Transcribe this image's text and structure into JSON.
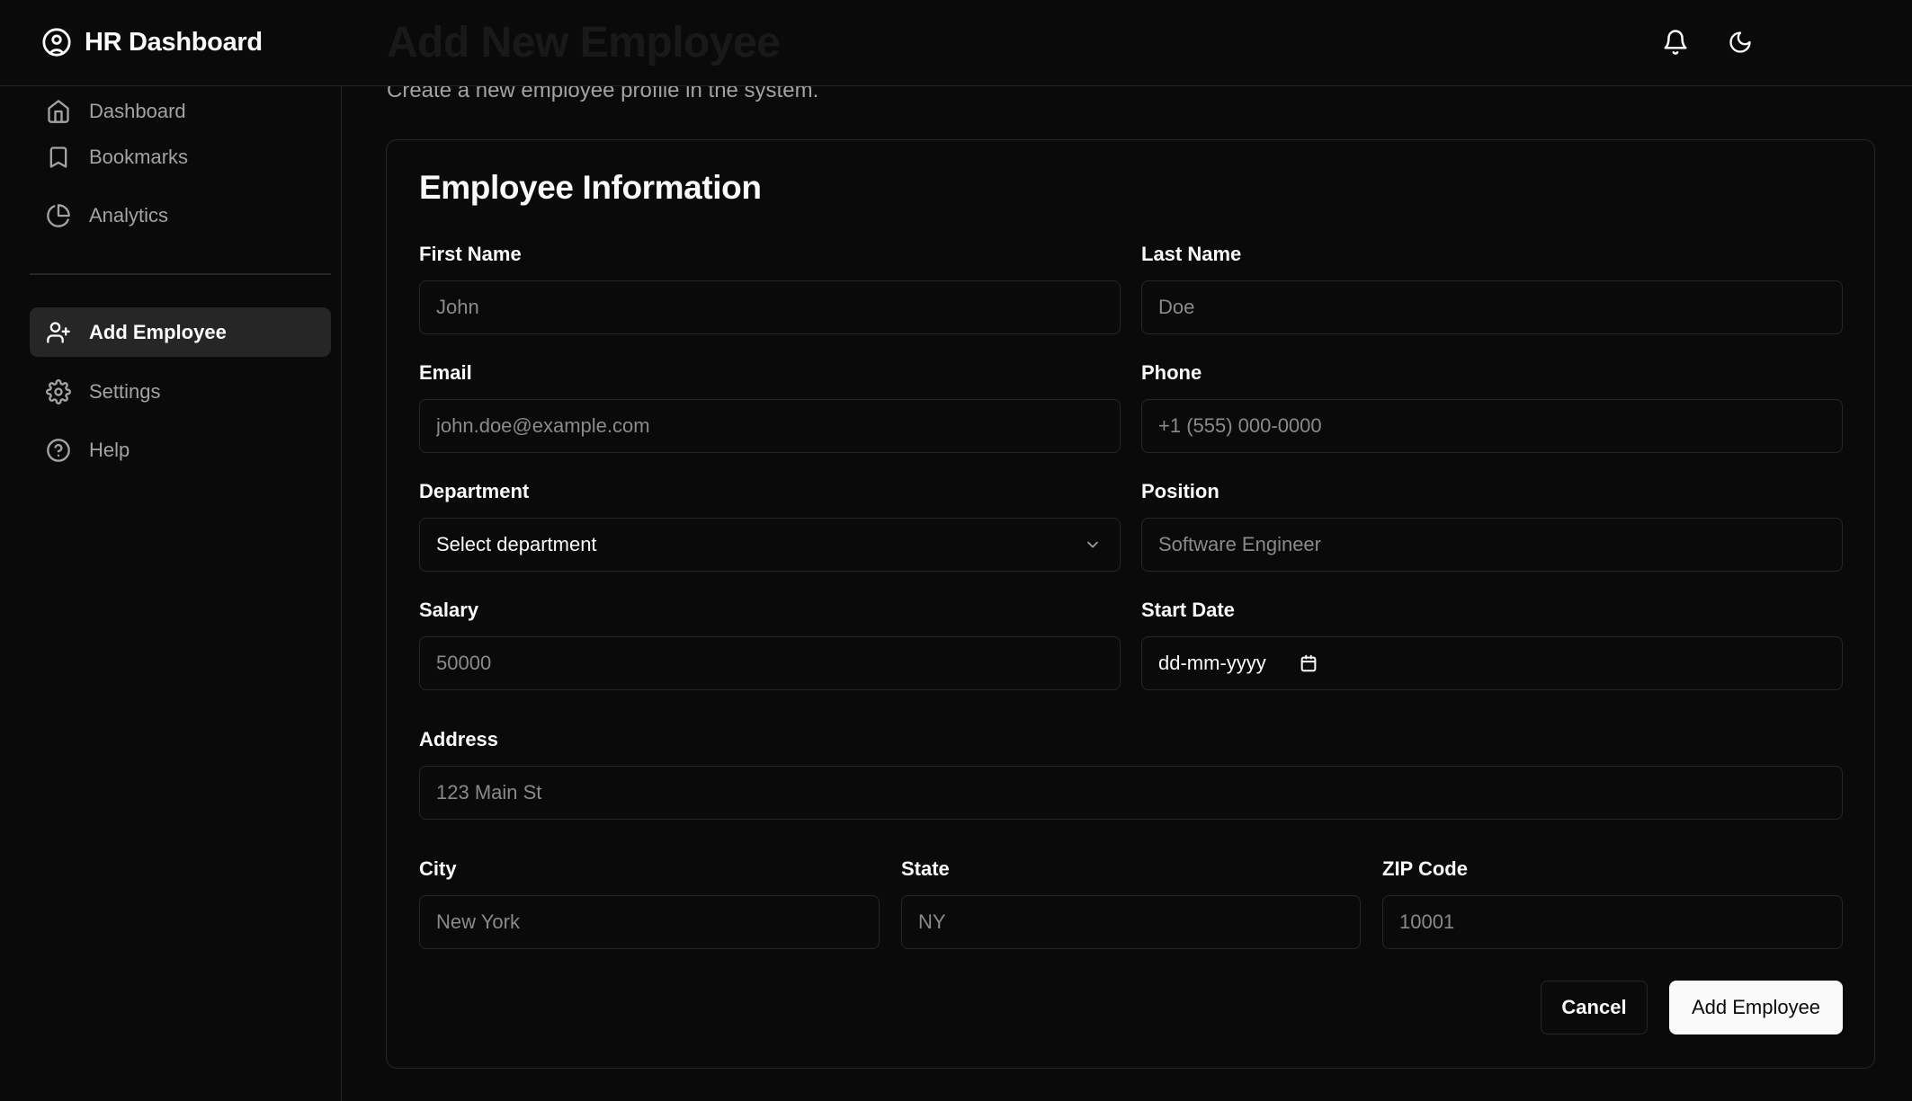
{
  "header": {
    "app_title": "HR Dashboard",
    "page_title_behind": "Add New Employee"
  },
  "sidebar": {
    "items": [
      {
        "label": "Dashboard",
        "icon": "home-icon"
      },
      {
        "label": "Bookmarks",
        "icon": "bookmark-icon"
      },
      {
        "label": "Analytics",
        "icon": "pie-chart-icon"
      },
      {
        "label": "Add Employee",
        "icon": "user-plus-icon",
        "active": true
      },
      {
        "label": "Settings",
        "icon": "gear-icon"
      },
      {
        "label": "Help",
        "icon": "help-circle-icon"
      }
    ]
  },
  "main": {
    "subtitle": "Create a new employee profile in the system.",
    "card_title": "Employee Information",
    "fields": {
      "first_name": {
        "label": "First Name",
        "placeholder": "John"
      },
      "last_name": {
        "label": "Last Name",
        "placeholder": "Doe"
      },
      "email": {
        "label": "Email",
        "placeholder": "john.doe@example.com"
      },
      "phone": {
        "label": "Phone",
        "placeholder": "+1 (555) 000-0000"
      },
      "department": {
        "label": "Department",
        "value": "Select department"
      },
      "position": {
        "label": "Position",
        "placeholder": "Software Engineer"
      },
      "salary": {
        "label": "Salary",
        "placeholder": "50000"
      },
      "start_date": {
        "label": "Start Date",
        "value": "dd-mm-yyyy"
      },
      "address": {
        "label": "Address",
        "placeholder": "123 Main St"
      },
      "city": {
        "label": "City",
        "placeholder": "New York"
      },
      "state": {
        "label": "State",
        "placeholder": "NY"
      },
      "zip": {
        "label": "ZIP Code",
        "placeholder": "10001"
      }
    },
    "actions": {
      "cancel": "Cancel",
      "submit": "Add Employee"
    }
  },
  "colors": {
    "background": "#0a0a0a",
    "border": "#262626",
    "text": "#fafafa",
    "muted": "#a3a3a3",
    "active_nav_bg": "#262626",
    "primary_button_bg": "#fafafa"
  }
}
